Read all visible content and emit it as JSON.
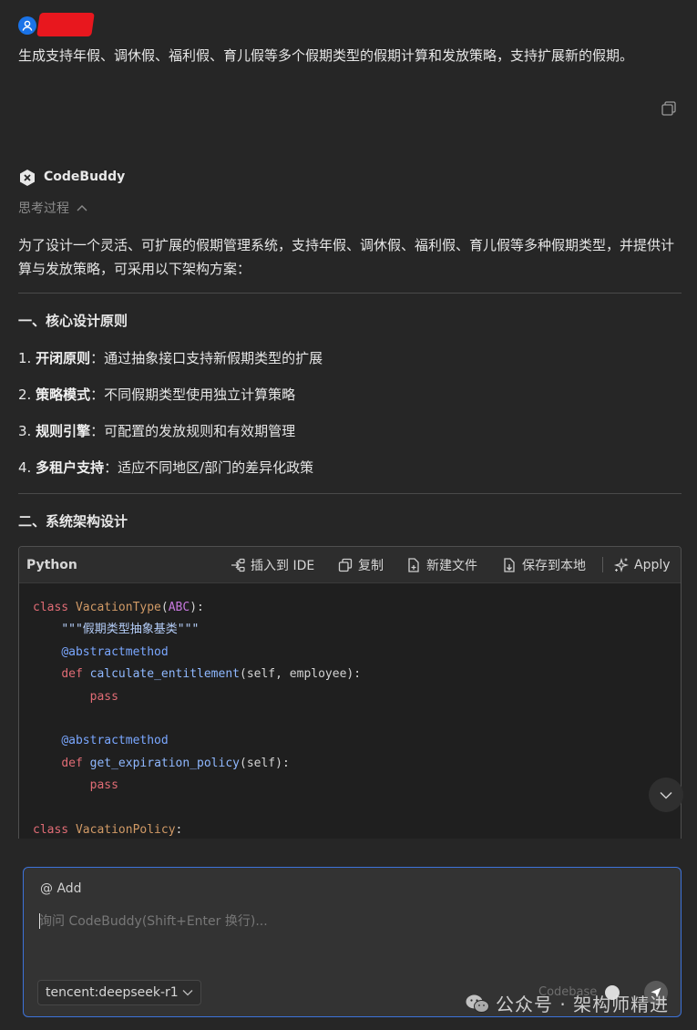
{
  "user": {
    "message": "生成支持年假、调休假、福利假、育儿假等多个假期类型的假期计算和发放策略，支持扩展新的假期。"
  },
  "assistant": {
    "name": "CodeBuddy",
    "thinking_label": "思考过程",
    "intro": "为了设计一个灵活、可扩展的假期管理系统，支持年假、调休假、福利假、育儿假等多种假期类型，并提供计算与发放策略，可采用以下架构方案：",
    "section1_title": "一、核心设计原则",
    "principles": [
      {
        "num": "1.",
        "title": "开闭原则",
        "desc": "：通过抽象接口支持新假期类型的扩展"
      },
      {
        "num": "2.",
        "title": "策略模式",
        "desc": "：不同假期类型使用独立计算策略"
      },
      {
        "num": "3.",
        "title": "规则引擎",
        "desc": "：可配置的发放规则和有效期管理"
      },
      {
        "num": "4.",
        "title": "多租户支持",
        "desc": "：适应不同地区/部门的差异化政策"
      }
    ],
    "section2_title": "二、系统架构设计"
  },
  "code_block": {
    "language": "Python",
    "toolbar": {
      "insert_ide": "插入到 IDE",
      "copy": "复制",
      "new_file": "新建文件",
      "save_local": "保存到本地",
      "apply": "Apply"
    },
    "lines": [
      {
        "tokens": [
          [
            "kw",
            "class "
          ],
          [
            "cls",
            "VacationType"
          ],
          [
            "p",
            "("
          ],
          [
            "ty",
            "ABC"
          ],
          [
            "p",
            "):"
          ]
        ]
      },
      {
        "tokens": [
          [
            "p",
            "    "
          ],
          [
            "str",
            "\"\"\"假期类型抽象基类\"\"\""
          ]
        ]
      },
      {
        "tokens": [
          [
            "p",
            "    "
          ],
          [
            "dec",
            "@abstractmethod"
          ]
        ]
      },
      {
        "tokens": [
          [
            "p",
            "    "
          ],
          [
            "kw",
            "def "
          ],
          [
            "fn",
            "calculate_entitlement"
          ],
          [
            "p",
            "(self, employee):"
          ]
        ]
      },
      {
        "tokens": [
          [
            "p",
            "        "
          ],
          [
            "kw",
            "pass"
          ]
        ]
      },
      {
        "tokens": [
          [
            "p",
            ""
          ]
        ]
      },
      {
        "tokens": [
          [
            "p",
            "    "
          ],
          [
            "dec",
            "@abstractmethod"
          ]
        ]
      },
      {
        "tokens": [
          [
            "p",
            "    "
          ],
          [
            "kw",
            "def "
          ],
          [
            "fn",
            "get_expiration_policy"
          ],
          [
            "p",
            "(self):"
          ]
        ]
      },
      {
        "tokens": [
          [
            "p",
            "        "
          ],
          [
            "kw",
            "pass"
          ]
        ]
      },
      {
        "tokens": [
          [
            "p",
            ""
          ]
        ]
      },
      {
        "tokens": [
          [
            "kw",
            "class "
          ],
          [
            "cls",
            "VacationPolicy"
          ],
          [
            "p",
            ":"
          ]
        ]
      }
    ]
  },
  "input": {
    "at_add": "@ Add",
    "placeholder": "询问 CodeBuddy(Shift+Enter 换行)...",
    "model": "tencent:deepseek-r1",
    "codebase": "Codebase"
  },
  "watermark": "公众号 · 架构师精进",
  "colors": {
    "background": "#262626",
    "accent_border": "#3d72d9",
    "avatar_blue": "#1a73e8",
    "redaction_red": "#e8171e"
  }
}
